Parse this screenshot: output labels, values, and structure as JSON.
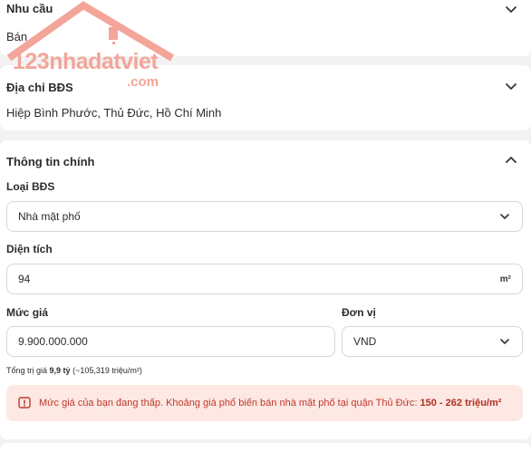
{
  "need": {
    "title": "Nhu cầu",
    "value": "Bán"
  },
  "address": {
    "title": "Địa chỉ BĐS",
    "value": "Hiệp Bình Phước, Thủ Đức, Hồ Chí Minh"
  },
  "main_info": {
    "title": "Thông tin chính",
    "property_type": {
      "label": "Loại BĐS",
      "value": "Nhà mặt phố"
    },
    "area": {
      "label": "Diện tích",
      "value": "94",
      "unit": "m²"
    },
    "price": {
      "label": "Mức giá",
      "value": "9.900.000.000"
    },
    "unit": {
      "label": "Đơn vị",
      "value": "VND"
    },
    "total": {
      "prefix": "Tổng trị giá",
      "amount": "9,9 tỷ",
      "per_m2": "(~105,319 triệu/m²)"
    },
    "warning": {
      "text": "Mức giá của bạn đang thấp. Khoảng giá phổ biến bán nhà mặt phố tại quận Thủ Đức:",
      "range": "150 - 262 triệu/m²"
    }
  },
  "watermark": {
    "name": "123nhadatviet",
    "suffix": ".com"
  },
  "colors": {
    "accent": "#c0392b",
    "warning_bg": "#fde8e3",
    "watermark": "#f3a59a",
    "border": "#d6d6d6"
  }
}
